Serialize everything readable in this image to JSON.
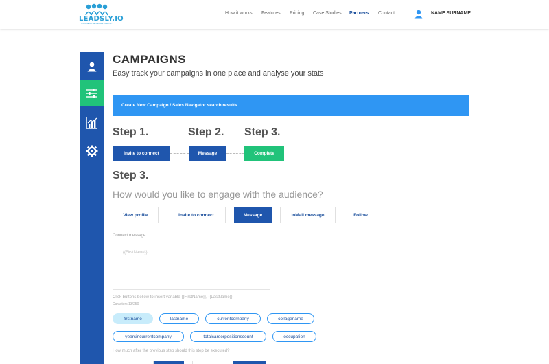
{
  "header": {
    "logo_text": "LEADSLY.IO",
    "logo_tagline": "CONNECT. ENGAGE. GROW.",
    "nav": [
      "How it works",
      "Features",
      "Pricing",
      "Case Studies",
      "Partners",
      "Contact"
    ],
    "active_nav": "Partners",
    "user_name": "NAME SURNAME"
  },
  "sidebar": {
    "items": [
      "user-icon",
      "sliders-icon",
      "chart-icon",
      "gear-icon"
    ],
    "active_index": 1
  },
  "page": {
    "title": "CAMPAIGNS",
    "subtitle": "Easy track your campaigns in one place and analyse your stats"
  },
  "banner": {
    "text": "Create New Campaign / Sales Navigator search results"
  },
  "steps": {
    "labels": [
      "Step 1.",
      "Step 2.",
      "Step 3."
    ],
    "buttons": [
      "Invite to connect",
      "Message",
      "Complete"
    ]
  },
  "step3": {
    "title": "Step 3.",
    "question": "How would you like to engage with the audience?",
    "options": [
      "View profile",
      "Invite to connect",
      "Message",
      "InMail message",
      "Follow"
    ],
    "selected_option": "Message"
  },
  "connect": {
    "label": "Connect message",
    "placeholder": "{{FirstName}}",
    "hint": "Click buttons bellow to insert variable {{FirstName}}, {{LastName}}",
    "counter": "Caracters 13/250"
  },
  "variables": {
    "row1": [
      "firstname",
      "lastname",
      "currentcompany",
      "collagename"
    ],
    "row2": [
      "yearsincurrentcompany",
      "totalcareerpositionscount",
      "occupation"
    ],
    "active": "firstname"
  },
  "delay_question": "How much after the previous step should this step be executed?",
  "colors": {
    "primary_blue": "#1f56ad",
    "banner_blue": "#2f96f3",
    "green": "#21c37a",
    "chip_active": "#c8ecfb"
  }
}
